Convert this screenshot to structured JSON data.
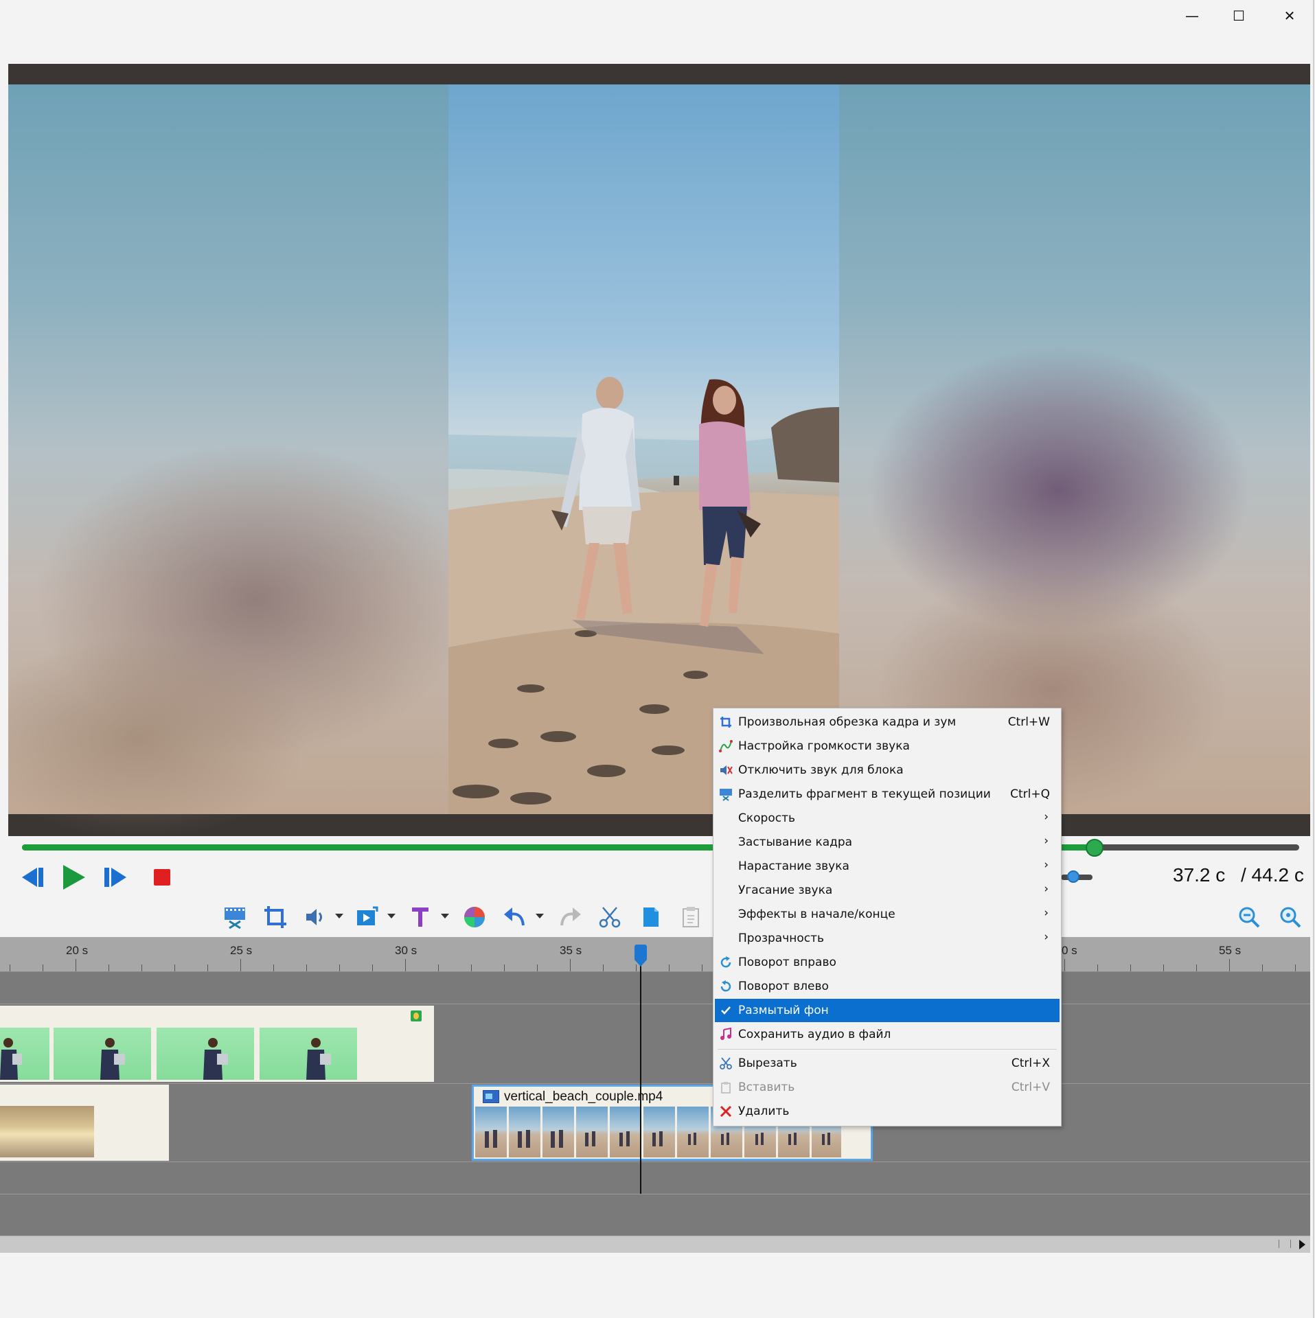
{
  "window": {
    "minimize_glyph": "—",
    "maximize_glyph": "☐",
    "close_glyph": "✕"
  },
  "player": {
    "current_time": "37.2 с",
    "total_time": "/ 44.2 с",
    "progress": 0.84
  },
  "toolbar": {
    "icons": [
      "split-film-icon",
      "crop-icon",
      "volume-icon",
      "video-effect-icon",
      "text-icon",
      "color-wheel-icon",
      "undo-icon",
      "redo-icon",
      "scissors-icon",
      "copy-icon",
      "paste-icon",
      "zoom-out-icon",
      "zoom-in-icon"
    ]
  },
  "timeline": {
    "ticks": [
      "20 s",
      "25 s",
      "30 s",
      "35 s",
      "0 s",
      "55 s"
    ],
    "clip_name": "vertical_beach_couple.mp4"
  },
  "context_menu": {
    "items": [
      {
        "label": "Произвольная обрезка кадра и зум",
        "shortcut": "Ctrl+W",
        "icon": "crop-icon"
      },
      {
        "label": "Настройка громкости звука",
        "shortcut": "",
        "icon": "volume-curve-icon"
      },
      {
        "label": "Отключить звук для блока",
        "shortcut": "",
        "icon": "mute-icon"
      },
      {
        "label": "Разделить фрагмент в текущей позиции",
        "shortcut": "Ctrl+Q",
        "icon": "split-icon"
      },
      {
        "label": "Скорость",
        "submenu": true
      },
      {
        "label": "Застывание кадра",
        "submenu": true
      },
      {
        "label": "Нарастание звука",
        "submenu": true
      },
      {
        "label": "Угасание звука",
        "submenu": true
      },
      {
        "label": "Эффекты в начале/конце",
        "submenu": true
      },
      {
        "label": "Прозрачность",
        "submenu": true
      },
      {
        "label": "Поворот вправо",
        "icon": "rotate-right-icon"
      },
      {
        "label": "Поворот влево",
        "icon": "rotate-left-icon"
      },
      {
        "label": "Размытый фон",
        "checked": true,
        "selected": true
      },
      {
        "label": "Сохранить аудио в файл",
        "icon": "save-audio-icon"
      },
      {
        "label": "Вырезать",
        "shortcut": "Ctrl+X",
        "icon": "cut-icon"
      },
      {
        "label": "Вставить",
        "shortcut": "Ctrl+V",
        "icon": "paste-icon",
        "disabled": true
      },
      {
        "label": "Удалить",
        "icon": "delete-icon"
      }
    ]
  },
  "colors": {
    "accent": "#0a6fce",
    "progress": "#1f9d3a",
    "stop": "#e02020",
    "play": "#1a9a3c",
    "transport_blue": "#1a6fd0"
  }
}
